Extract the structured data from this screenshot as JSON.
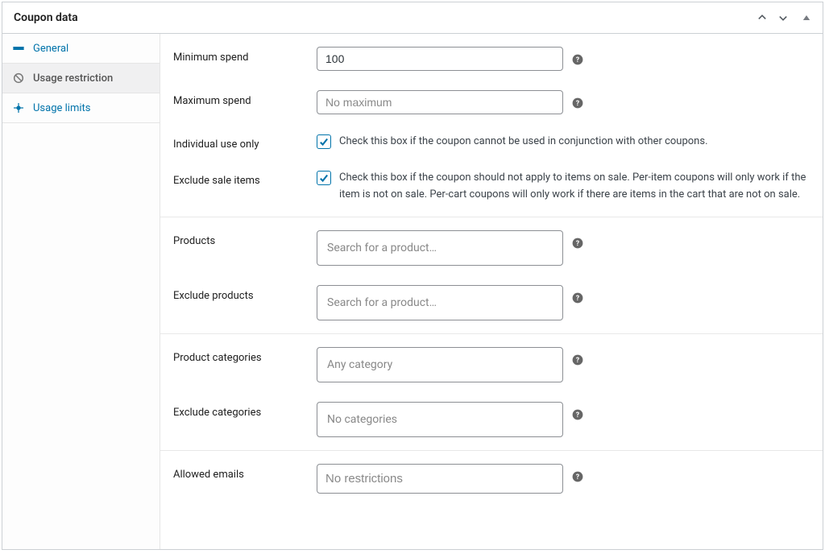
{
  "panel": {
    "title": "Coupon data"
  },
  "tabs": {
    "general": "General",
    "usage_restriction": "Usage restriction",
    "usage_limits": "Usage limits"
  },
  "fields": {
    "minimum_spend": {
      "label": "Minimum spend",
      "value": "100"
    },
    "maximum_spend": {
      "label": "Maximum spend",
      "placeholder": "No maximum"
    },
    "individual_use": {
      "label": "Individual use only",
      "description": "Check this box if the coupon cannot be used in conjunction with other coupons."
    },
    "exclude_sale_items": {
      "label": "Exclude sale items",
      "description": "Check this box if the coupon should not apply to items on sale. Per-item coupons will only work if the item is not on sale. Per-cart coupons will only work if there are items in the cart that are not on sale."
    },
    "products": {
      "label": "Products",
      "placeholder": "Search for a product…"
    },
    "exclude_products": {
      "label": "Exclude products",
      "placeholder": "Search for a product…"
    },
    "product_categories": {
      "label": "Product categories",
      "placeholder": "Any category"
    },
    "exclude_categories": {
      "label": "Exclude categories",
      "placeholder": "No categories"
    },
    "allowed_emails": {
      "label": "Allowed emails",
      "placeholder": "No restrictions"
    }
  }
}
